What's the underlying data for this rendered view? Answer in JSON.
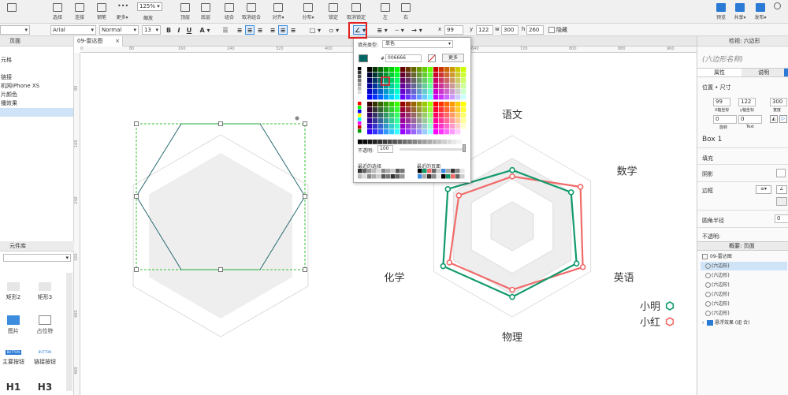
{
  "toolbar": {
    "left_buttons": [
      {
        "label": "选择",
        "icon": "select-icon"
      },
      {
        "label": "连接",
        "icon": "connect-icon"
      },
      {
        "label": "钢笔",
        "icon": "pen-icon"
      },
      {
        "label": "更多▾",
        "icon": "more-icon"
      }
    ],
    "zoom": "125%",
    "zoom_label": "缩放",
    "mid_buttons": [
      {
        "label": "顶层",
        "icon": "bring-front-icon"
      },
      {
        "label": "底层",
        "icon": "send-back-icon"
      },
      {
        "label": "组合",
        "icon": "group-icon"
      },
      {
        "label": "取消组合",
        "icon": "ungroup-icon"
      },
      {
        "label": "对齐▾",
        "icon": "align-icon"
      },
      {
        "label": "分布▾",
        "icon": "distribute-icon"
      },
      {
        "label": "锁定",
        "icon": "lock-icon"
      },
      {
        "label": "取消锁定",
        "icon": "unlock-icon"
      },
      {
        "label": "左",
        "icon": "left-icon"
      },
      {
        "label": "右",
        "icon": "right-icon"
      }
    ],
    "right_buttons": [
      {
        "label": "预览",
        "icon": "preview-icon"
      },
      {
        "label": "共享▾",
        "icon": "share-icon"
      },
      {
        "label": "发布▾",
        "icon": "publish-icon"
      }
    ]
  },
  "formatbar": {
    "style": "",
    "font": "Arial",
    "weight": "Normal",
    "size": "13",
    "x_label": "x",
    "x": "99",
    "y_label": "y",
    "y": "122",
    "w_label": "w",
    "w": "300",
    "h_label": "h",
    "h": "260",
    "hidden_label": "隐藏"
  },
  "left_panel": {
    "pages_title": "页面",
    "pages": [
      "元格",
      "",
      "链接",
      "机网iPhone XS",
      "片颜色",
      "播效果",
      ""
    ],
    "library_title": "元件库",
    "widgets": [
      {
        "label": "矩形2"
      },
      {
        "label": "矩形3"
      },
      {
        "label": "图片"
      },
      {
        "label": "占位符"
      },
      {
        "label": "主要按钮",
        "text": "BUTTON"
      },
      {
        "label": "链接按钮",
        "text": "BUTTON"
      },
      {
        "label": "H1"
      },
      {
        "label": "H3"
      }
    ]
  },
  "canvas": {
    "tab_label": "09-雷达图",
    "ruler_top": [
      "0",
      "80",
      "160",
      "240",
      "320",
      "400",
      "480",
      "560",
      "640",
      "720",
      "800",
      "880",
      "960"
    ],
    "ruler_left": [
      "80",
      "160",
      "240",
      "320",
      "400",
      "480"
    ]
  },
  "color_picker": {
    "fill_type_label": "填充类型:",
    "fill_type": "单色",
    "hex_prefix": "#",
    "hex": "006666",
    "more_label": "更多",
    "opacity_label": "不透明:",
    "opacity": "100",
    "recent_colors_label": "最近的选择",
    "recent_pages_label": "最近的页面"
  },
  "right_panel": {
    "inspector_title": "检视: 六边形",
    "shape_name": "(六边形名称)",
    "tabs": [
      "属性",
      "说明"
    ],
    "position_label": "位置 • 尺寸",
    "x": "99",
    "y": "122",
    "w": "300",
    "x_label": "X轴坐标",
    "y_label": "y轴坐标",
    "w_label": "宽度",
    "rot": "0",
    "text_rot": "0",
    "rot_label": "旋转",
    "text_label": "Text",
    "box_name": "Box 1",
    "fill_label": "填充",
    "shadow_label": "阴影",
    "border_label": "边框",
    "radius_label": "圆角半径",
    "radius": "0",
    "opacity_label": "不透明:",
    "outline_title": "概要: 页面",
    "outline_root": "09-雷达图",
    "outline_items": [
      "(六边形)",
      "(六边形)",
      "(六边形)",
      "(六边形)",
      "(六边形)",
      "(六边形)"
    ],
    "outline_folder": "悬浮效果 (组 合)"
  },
  "chart_data": {
    "type": "radar",
    "categories": [
      "语文",
      "数学",
      "英语",
      "物理",
      "化学",
      ""
    ],
    "series": [
      {
        "name": "小明",
        "color": "#129a6c",
        "values": [
          0.62,
          0.75,
          0.82,
          0.78,
          0.88,
          0.82
        ]
      },
      {
        "name": "小红",
        "color": "#f06a6a",
        "values": [
          0.55,
          0.87,
          0.9,
          0.7,
          0.8,
          0.68
        ]
      }
    ],
    "rings": 3,
    "ring_fills": [
      "#ffffff",
      "#eeeeee",
      "#ffffff",
      "#eeeeee"
    ]
  },
  "colors": {
    "accent": "#3c8dde",
    "highlight": "#e02020",
    "selection": "#cfe5f7",
    "edit_stroke": "#2a6b70",
    "edit_green": "#1faa3a",
    "guide_green": "#34c234"
  }
}
